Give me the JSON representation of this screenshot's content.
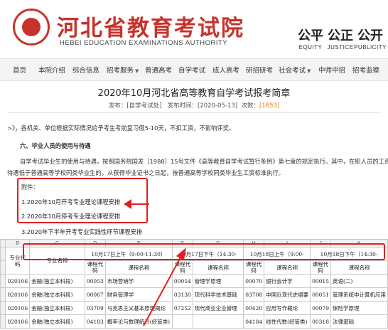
{
  "site": {
    "title_cn": "河北省教育考试院",
    "title_en": "HEBEI EDUCATION EXAMINATIONS AUTHORITY",
    "values": [
      {
        "glyph": "公平",
        "label": "EQUITY"
      },
      {
        "glyph": "公正",
        "label": "JUSTICE"
      },
      {
        "glyph": "公开",
        "label": "PUBLICITY"
      }
    ]
  },
  "nav": {
    "items": [
      {
        "label": "首页"
      },
      {
        "label": "本院介绍"
      },
      {
        "label": "综合信息"
      },
      {
        "label": "招考服务"
      },
      {
        "label": "普通高考"
      },
      {
        "label": "自学考试"
      },
      {
        "label": "成人高考"
      },
      {
        "label": "研招研考"
      },
      {
        "label": "社会考试"
      },
      {
        "label": "中师中招"
      },
      {
        "label": "招考监察"
      }
    ]
  },
  "article": {
    "title": "2020年10月河北省高等教育自学考试报考简章",
    "meta": {
      "source_label": "发布：",
      "source": "[自学考试处]",
      "date_label": "发布时间：",
      "date": "[2020-05-13]",
      "hits_label": "次数：",
      "hits": "[1653]"
    },
    "para_top": ">》，各机关、单位根据实际情况给予考生考前复习假5-10天，不扣工资，不影响评奖。",
    "section_heading": "六、毕业人员的使用与待遇",
    "body_line1": "自学考试毕业生的使用与待遇，按照国务院国发［1988］15号文件《高等教育自学考试暂行条例》第七章的规定执行。其中，在职人员的工资",
    "body_line2": "待遇低于普通高等学校同类毕业生的，从获得毕业证书之日起，按普通高等学校同类毕业生工资标准执行。",
    "attachments": {
      "label": "附件：",
      "items": [
        "1.2020年10月开考专业理论课程安排",
        "2.2020年10月停考专业理论课程安排",
        "3.2020年下半年开考专业实践性环节课程安排"
      ]
    }
  },
  "sheet": {
    "col_letters": [
      "B",
      "C",
      "D",
      "E",
      "F",
      "G",
      "H",
      "I",
      "J",
      "K"
    ],
    "time_headers": [
      "10月17日上午（9:00-11:30）",
      "10月17日下午（14:30-",
      "10月18日上午（9:00-",
      "10月18日下午（14:30-"
    ],
    "col_headers": {
      "major_code": "专业代码",
      "major_name": "专业名称",
      "course_code": "课程代码",
      "course_name": "课程名称"
    },
    "rows": [
      {
        "rn": "",
        "code": "020106",
        "name": "金融(独立本科段)",
        "c1": "00053",
        "n1": "市场营销学",
        "c2": "00054",
        "n2": "管理学原理",
        "c3": "00070",
        "n3": "银行会计学",
        "c4": "00015",
        "n4": "英语(二)"
      },
      {
        "rn": "",
        "code": "020106",
        "name": "金融(独立本科段)",
        "c1": "00067",
        "n1": "财务管理学",
        "c2": "03130",
        "n2": "现代科学技术基础",
        "c3": "03708",
        "n3": "中国近现代史纲要",
        "c4": "00051",
        "n4": "管理系统中计算机应用"
      },
      {
        "rn": "",
        "code": "020106",
        "name": "金融(独立本科段)",
        "c1": "03709",
        "n1": "马克思主义基本原理概论",
        "c2": "07252",
        "n2": "现代商业企业管理",
        "c3": "00420",
        "n3": "应用写作概论",
        "c4": "00079",
        "n4": "保险学原理"
      },
      {
        "rn": "",
        "code": "020106",
        "name": "金融(独立本科段)",
        "c1": "04183",
        "n1": "概率论与数理统计(经管类)",
        "c2": "",
        "n2": "",
        "c3": "04184",
        "n3": "线性代数(经管类)",
        "c4": "00318",
        "n4": "法律基础"
      }
    ]
  }
}
